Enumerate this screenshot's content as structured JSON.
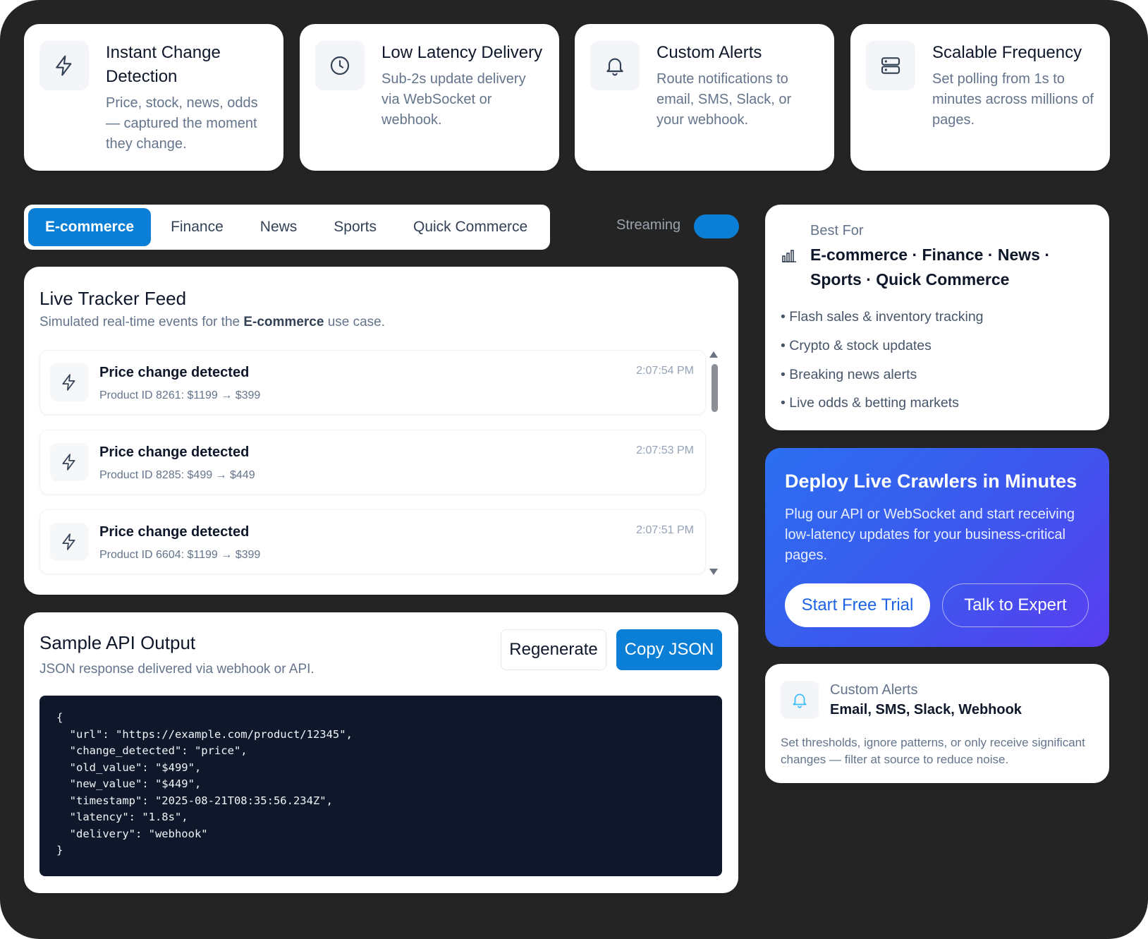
{
  "features": [
    {
      "title": "Instant Change Detection",
      "desc": "Price, stock, news, odds — captured the moment they change.",
      "icon": "lightning-icon"
    },
    {
      "title": "Low Latency Delivery",
      "desc": "Sub-2s update delivery via WebSocket or webhook.",
      "icon": "clock-icon"
    },
    {
      "title": "Custom Alerts",
      "desc": "Route notifications to email, SMS, Slack, or your webhook.",
      "icon": "bell-icon"
    },
    {
      "title": "Scalable Frequency",
      "desc": "Set polling from 1s to minutes across millions of pages.",
      "icon": "server-icon"
    }
  ],
  "tabs": [
    "E-commerce",
    "Finance",
    "News",
    "Sports",
    "Quick Commerce"
  ],
  "streaming_label": "Streaming",
  "feed": {
    "title": "Live Tracker Feed",
    "sub_prefix": "Simulated real-time events for the ",
    "sub_bold": "E-commerce",
    "sub_suffix": " use case.",
    "events": [
      {
        "title": "Price change detected",
        "desc": "Product ID 8261: $1199 → $399",
        "time": "2:07:54 PM"
      },
      {
        "title": "Price change detected",
        "desc": "Product ID 8285: $499 → $449",
        "time": "2:07:53 PM"
      },
      {
        "title": "Price change detected",
        "desc": "Product ID 6604: $1199 → $399",
        "time": "2:07:51 PM"
      }
    ]
  },
  "api": {
    "title": "Sample API Output",
    "sub": "JSON response delivered via webhook or API.",
    "regenerate": "Regenerate",
    "copy": "Copy JSON",
    "code": "{\n  \"url\": \"https://example.com/product/12345\",\n  \"change_detected\": \"price\",\n  \"old_value\": \"$499\",\n  \"new_value\": \"$449\",\n  \"timestamp\": \"2025-08-21T08:35:56.234Z\",\n  \"latency\": \"1.8s\",\n  \"delivery\": \"webhook\"\n}"
  },
  "best_for": {
    "label": "Best For",
    "title": "E-commerce · Finance · News · Sports · Quick Commerce",
    "bullets": [
      "• Flash sales & inventory tracking",
      "• Crypto & stock updates",
      "• Breaking news alerts",
      "• Live odds & betting markets"
    ]
  },
  "deploy": {
    "title": "Deploy Live Crawlers in Minutes",
    "desc": "Plug our API or WebSocket and start receiving low-latency updates for your business-critical pages.",
    "trial": "Start Free Trial",
    "expert": "Talk to Expert"
  },
  "alerts": {
    "label": "Custom Alerts",
    "title": "Email, SMS, Slack, Webhook",
    "desc": "Set thresholds, ignore patterns, or only receive significant changes — filter at source to reduce noise."
  },
  "colors": {
    "frame": "#242424",
    "accent": "#0b7fd6",
    "code_bg": "#0f172a",
    "deploy_start": "#2b6ff0",
    "deploy_end": "#5a3df0"
  }
}
